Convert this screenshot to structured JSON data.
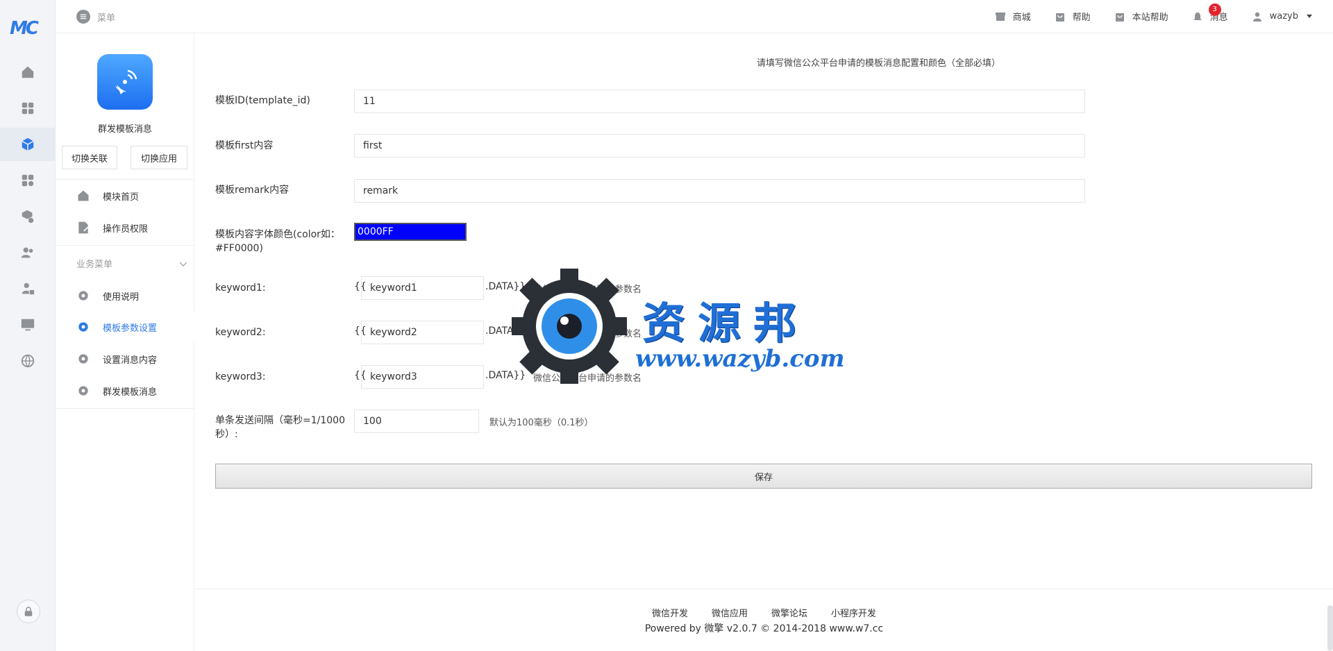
{
  "rail": {
    "logo": "MC",
    "items": [
      {
        "icon": "home-icon"
      },
      {
        "icon": "apps-grid-icon"
      },
      {
        "icon": "cube-icon",
        "active": true
      },
      {
        "icon": "modules-icon"
      },
      {
        "icon": "package-settings-icon"
      },
      {
        "icon": "users-icon"
      },
      {
        "icon": "user-lock-icon"
      },
      {
        "icon": "monitor-icon"
      },
      {
        "icon": "globe-icon"
      }
    ],
    "lock_icon": "lock-icon"
  },
  "topbar": {
    "menu_label": "菜单",
    "links": {
      "shop": "商城",
      "help": "帮助",
      "site_help": "本站帮助",
      "messages": "消息",
      "messages_count": "3",
      "user": "wazyb"
    }
  },
  "sidebar": {
    "app_name": "群发模板消息",
    "switch_link": "切换关联",
    "switch_app": "切换应用",
    "items": [
      {
        "label": "模块首页"
      },
      {
        "label": "操作员权限"
      }
    ],
    "group_label": "业务菜单",
    "biz_items": [
      {
        "label": "使用说明"
      },
      {
        "label": "模板参数设置"
      },
      {
        "label": "设置消息内容"
      },
      {
        "label": "群发模板消息"
      }
    ]
  },
  "form": {
    "heading": "请填写微信公众平台申请的模板消息配置和颜色（全部必填）",
    "template_id_label": "模板ID(template_id)",
    "template_id_value": "11",
    "first_label": "模板first内容",
    "first_value": "first",
    "remark_label": "模板remark内容",
    "remark_value": "remark",
    "color_label_1": "模板内容字体颜色(color如：",
    "color_label_2": "#FF0000)",
    "color_value": "0000FF",
    "kw_prefix": "{{",
    "kw_suffix": ".DATA}}",
    "kw_hint": "微信公众平台申请的参数名",
    "keyword1_label": "keyword1:",
    "keyword1_value": "keyword1",
    "keyword2_label": "keyword2:",
    "keyword2_value": "keyword2",
    "keyword3_label": "keyword3:",
    "keyword3_value": "keyword3",
    "interval_label_1": "单条发送间隔（毫秒=1/1000",
    "interval_label_2": "秒）:",
    "interval_value": "100",
    "interval_hint": "默认为100毫秒（0.1秒）",
    "save_label": "保存"
  },
  "footer": {
    "links": [
      "微信开发",
      "微信应用",
      "微擎论坛",
      "小程序开发"
    ],
    "powered": "Powered by 微擎 v2.0.7 © 2014-2018 www.w7.cc"
  },
  "watermark": {
    "text": "资源邦",
    "url": "www.wazyb.com"
  },
  "colors": {
    "accent": "#2f7be6",
    "badge": "#e2232e",
    "color_swatch": "#0000ff"
  }
}
